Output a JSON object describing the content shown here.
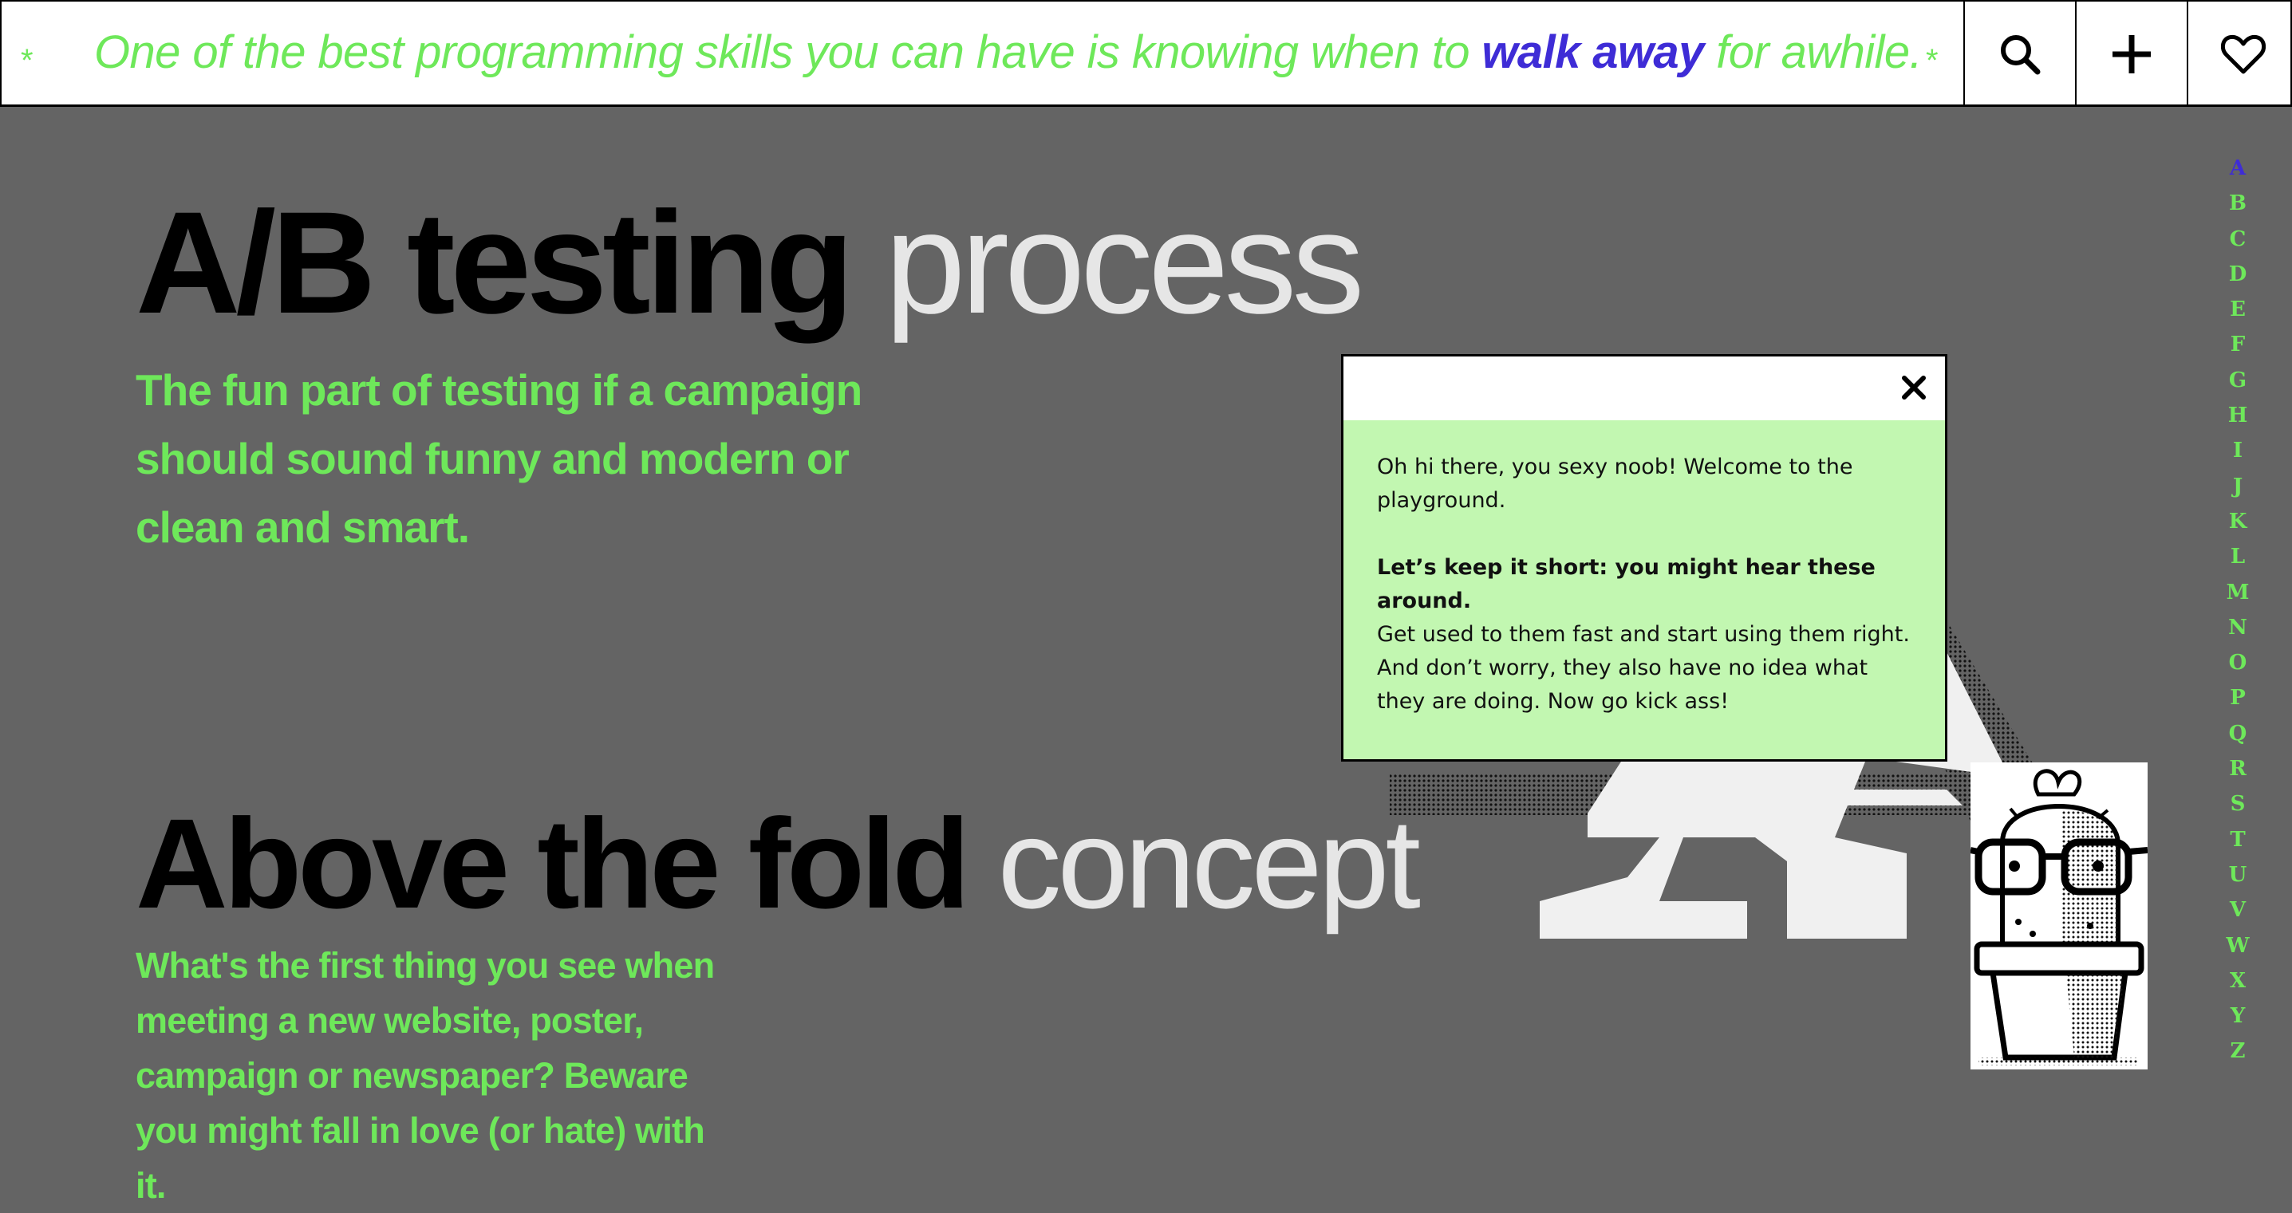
{
  "header": {
    "quote_star": "*",
    "quote_before": "One of the best programming skills you can have is knowing when to ",
    "quote_highlight": "walk away",
    "quote_after": " for awhile.",
    "icons": [
      "search-icon",
      "plus-icon",
      "heart-icon"
    ]
  },
  "alphabet": [
    "A",
    "B",
    "C",
    "D",
    "E",
    "F",
    "G",
    "H",
    "I",
    "J",
    "K",
    "L",
    "M",
    "N",
    "O",
    "P",
    "Q",
    "R",
    "S",
    "T",
    "U",
    "V",
    "W",
    "X",
    "Y",
    "Z"
  ],
  "alphabet_active": "A",
  "sections": [
    {
      "title_bold": "A/B testing",
      "title_light": "process",
      "description": "The fun part of testing if a campaign should sound funny and modern or clean and smart."
    },
    {
      "title_bold": "Above the fold",
      "title_light": "concept",
      "description": "What's the first thing you see when meeting a new website, poster, campaign or newspaper? Beware you might fall in love (or hate) with it."
    }
  ],
  "decoration": {
    "letter": "A"
  },
  "modal": {
    "close_symbol": "×",
    "intro": "Oh hi there, you sexy noob! Welcome to the playground.",
    "bold_line": "Let’s keep it short: you might hear these around.",
    "body": "Get used to them fast and start using them right. And don’t worry, they also have no idea what they are doing. Now go kick ass!"
  },
  "colors": {
    "background": "#646464",
    "accent_green": "#6ee85a",
    "accent_purple": "#3e2cd6",
    "modal_bg": "#c2f7b1",
    "title_light": "#e6e6e6"
  }
}
